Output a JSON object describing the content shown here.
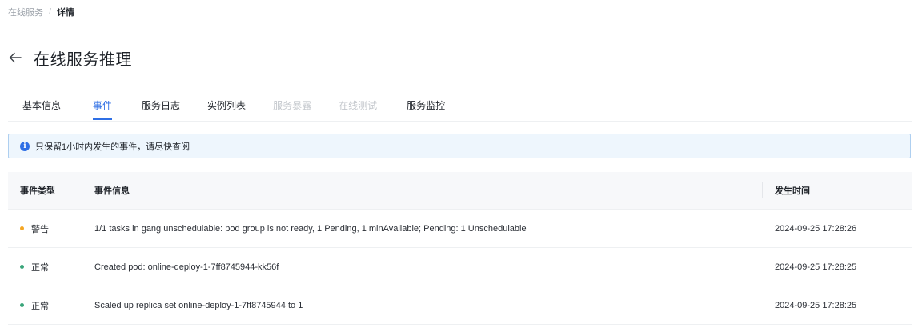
{
  "breadcrumb": {
    "parent": "在线服务",
    "separator": "/",
    "current": "详情"
  },
  "header": {
    "back_icon": "arrow-left-icon",
    "title": "在线服务推理"
  },
  "tabs": [
    {
      "label": "基本信息",
      "state": "normal"
    },
    {
      "label": "事件",
      "state": "active"
    },
    {
      "label": "服务日志",
      "state": "normal"
    },
    {
      "label": "实例列表",
      "state": "normal"
    },
    {
      "label": "服务暴露",
      "state": "disabled"
    },
    {
      "label": "在线测试",
      "state": "disabled"
    },
    {
      "label": "服务监控",
      "state": "normal"
    }
  ],
  "alert": {
    "icon": "info-icon",
    "text": "只保留1小时内发生的事件，请尽快查阅"
  },
  "table": {
    "columns": [
      "事件类型",
      "事件信息",
      "发生时间"
    ],
    "rows": [
      {
        "type": "警告",
        "status_color": "#f5a623",
        "message": "1/1 tasks in gang unschedulable: pod group is not ready, 1 Pending, 1 minAvailable; Pending: 1 Unschedulable",
        "time": "2024-09-25 17:28:26"
      },
      {
        "type": "正常",
        "status_color": "#3aa57a",
        "message": "Created pod: online-deploy-1-7ff8745944-kk56f",
        "time": "2024-09-25 17:28:25"
      },
      {
        "type": "正常",
        "status_color": "#3aa57a",
        "message": "Scaled up replica set online-deploy-1-7ff8745944 to 1",
        "time": "2024-09-25 17:28:25"
      }
    ]
  },
  "colors": {
    "accent": "#2f6fe5",
    "warning": "#f5a623",
    "normal": "#3aa57a"
  }
}
